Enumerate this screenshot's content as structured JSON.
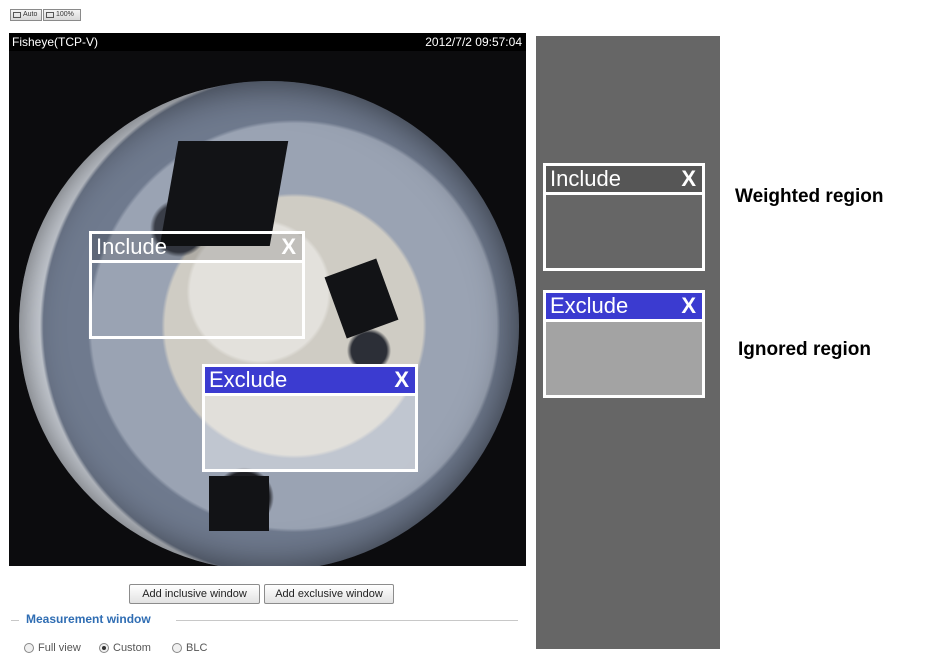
{
  "toolbar": {
    "zoom_auto_label": "Auto",
    "zoom_100_label": "100%"
  },
  "video": {
    "stream_name": "Fisheye(TCP-V)",
    "timestamp": "2012/7/2 09:57:04"
  },
  "regions": {
    "include_label": "Include",
    "exclude_label": "Exclude",
    "close_glyph": "X"
  },
  "buttons": {
    "add_inclusive": "Add inclusive window",
    "add_exclusive": "Add exclusive window"
  },
  "measurement": {
    "title": "Measurement window",
    "options": [
      {
        "label": "Full view",
        "selected": false
      },
      {
        "label": "Custom",
        "selected": true
      },
      {
        "label": "BLC",
        "selected": false
      }
    ]
  },
  "legend": {
    "include_label": "Include",
    "exclude_label": "Exclude",
    "weighted_text": "Weighted region",
    "ignored_text": "Ignored region"
  },
  "colors": {
    "exclude_header": "#3b3bd0",
    "legend_panel": "#666666",
    "section_title": "#2f6db3"
  }
}
